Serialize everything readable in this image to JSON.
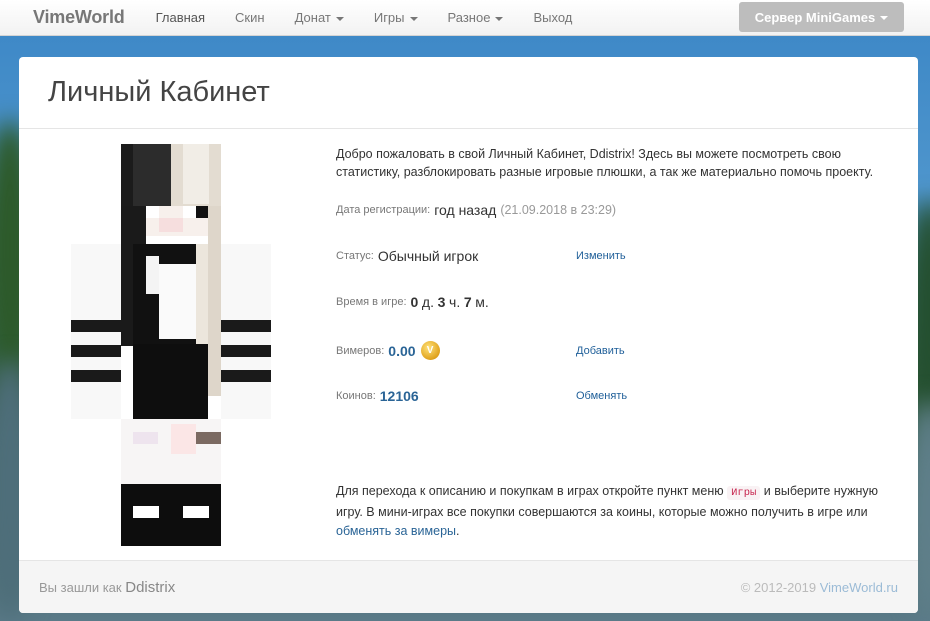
{
  "navbar": {
    "brand": "VimeWorld",
    "items": [
      {
        "label": "Главная",
        "active": true,
        "dropdown": false
      },
      {
        "label": "Скин",
        "active": false,
        "dropdown": false
      },
      {
        "label": "Донат",
        "active": false,
        "dropdown": true
      },
      {
        "label": "Игры",
        "active": false,
        "dropdown": true
      },
      {
        "label": "Разное",
        "active": false,
        "dropdown": true
      },
      {
        "label": "Выход",
        "active": false,
        "dropdown": false
      }
    ],
    "server_button": "Сервер MiniGames"
  },
  "panel": {
    "title": "Личный Кабинет",
    "welcome": "Добро пожаловать в свой Личный Кабинет, Ddistrix! Здесь вы можете посмотреть свою статистику, разблокировать разные игровые плюшки, а так же материально помочь проекту.",
    "registration": {
      "label": "Дата регистрации:",
      "value": "год назад",
      "detail": "(21.09.2018 в 23:29)"
    },
    "status": {
      "label": "Статус:",
      "value": "Обычный игрок",
      "action": "Изменить"
    },
    "playtime": {
      "label": "Время в игре:",
      "days": "0",
      "days_unit": "д.",
      "hours": "3",
      "hours_unit": "ч.",
      "minutes": "7",
      "minutes_unit": "м."
    },
    "vimers": {
      "label": "Вимеров:",
      "value": "0.00",
      "action": "Добавить",
      "icon": "vimer-coin-icon"
    },
    "coins": {
      "label": "Коинов:",
      "value": "12106",
      "action": "Обменять"
    },
    "info": {
      "part1": "Для перехода к описанию и покупкам в играх откройте пункт меню",
      "code": "Игры",
      "part2": "и выберите нужную игру. В мини-играх все покупки совершаются за коины, которые можно получить в игре или",
      "link": "обменять за вимеры",
      "end": "."
    }
  },
  "footer": {
    "prefix": "Вы зашли как",
    "nick": "Ddistrix",
    "copyright": "© 2012-2019",
    "site": "VimeWorld.ru"
  },
  "colors": {
    "link": "#2a6496",
    "action": "#1f5f99",
    "server_button": "#bdbdbd"
  }
}
